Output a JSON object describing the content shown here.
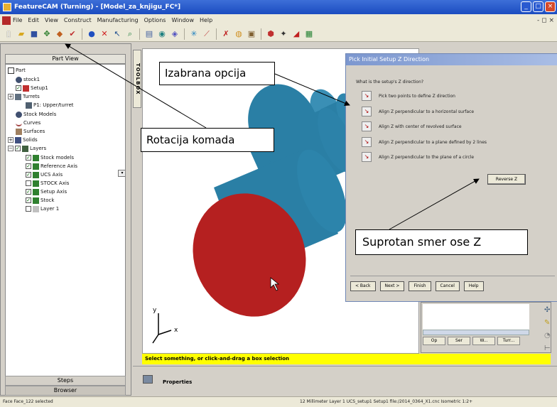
{
  "window": {
    "title": "FeatureCAM (Turning) - [Model_za_knjigu_FC*]",
    "controls": [
      "_",
      "□",
      "×"
    ]
  },
  "menu": {
    "items": [
      "File",
      "Edit",
      "View",
      "Construct",
      "Manufacturing",
      "Options",
      "Window",
      "Help"
    ],
    "mdi_controls": "- ◻ ×"
  },
  "toolbar": {
    "icons": [
      "new-icon",
      "open-icon",
      "save-icon",
      "rotate-icon",
      "orient-icon",
      "check-icon",
      "stop-icon",
      "delete-icon",
      "select-icon",
      "zoom-icon",
      "layers-icon",
      "eye-icon",
      "snap-icon",
      "point-icon",
      "line-icon",
      "color-icon",
      "shade-icon",
      "box-icon",
      "cube-icon",
      "tool-icon",
      "sim-icon",
      "report-icon"
    ]
  },
  "left_panel": {
    "header": "Part View",
    "tree": [
      {
        "label": "Part"
      },
      {
        "label": "stock1"
      },
      {
        "label": "Setup1"
      },
      {
        "label": "Turrets"
      },
      {
        "label": "P1: Upper/turret"
      },
      {
        "label": "Stock Models"
      },
      {
        "label": "Curves"
      },
      {
        "label": "Surfaces"
      },
      {
        "label": "Solids"
      },
      {
        "label": "Layers"
      },
      {
        "label": "Stock models"
      },
      {
        "label": "Reference Axis"
      },
      {
        "label": "UCS Axis"
      },
      {
        "label": "STOCK Axis"
      },
      {
        "label": "Setup Axis"
      },
      {
        "label": "Stock"
      },
      {
        "label": "Layer 1"
      }
    ],
    "steps_tab": "Steps",
    "browser_tab": "Browser"
  },
  "toolbox_label": "TOOLBOX",
  "viewport": {
    "axis_x": "x",
    "axis_y": "y",
    "prompt": "Select something, or click-and-drag a box selection",
    "properties_label": "Properties"
  },
  "dialog": {
    "title": "Pick Initial Setup Z Direction",
    "question": "What is the setup's Z direction?",
    "options": [
      "Pick two points to define Z direction",
      "Align Z perpendicular to a horizontal surface",
      "Align Z with center of revolved surface",
      "Align Z perpendicular to a plane defined by 2 lines",
      "Align Z perpendicular to the plane of a circle"
    ],
    "reverse_label": "Reverse Z",
    "buttons": [
      "< Back",
      "Next >",
      "Finish",
      "Cancel",
      "Help"
    ]
  },
  "right_panel": {
    "tabs": [
      "Op",
      "Ser",
      "W...",
      "Turr..."
    ]
  },
  "statusbar": {
    "left": "Face Face_122 selected",
    "right": "12  Millimeter   Layer 1   UCS_setup1   Setup1   file:/2014_0364_X1.cnc   Isometric   1:2+"
  },
  "annotations": {
    "izabrana": "Izabrana opcija",
    "rotacija": "Rotacija komada",
    "suprotan": "Suprotan smer ose Z"
  },
  "colors": {
    "solid_body": "#2a7fa5",
    "solid_face": "#b52020",
    "prompt_bg": "#ffff00",
    "title_bar": "#2a5ad0"
  }
}
